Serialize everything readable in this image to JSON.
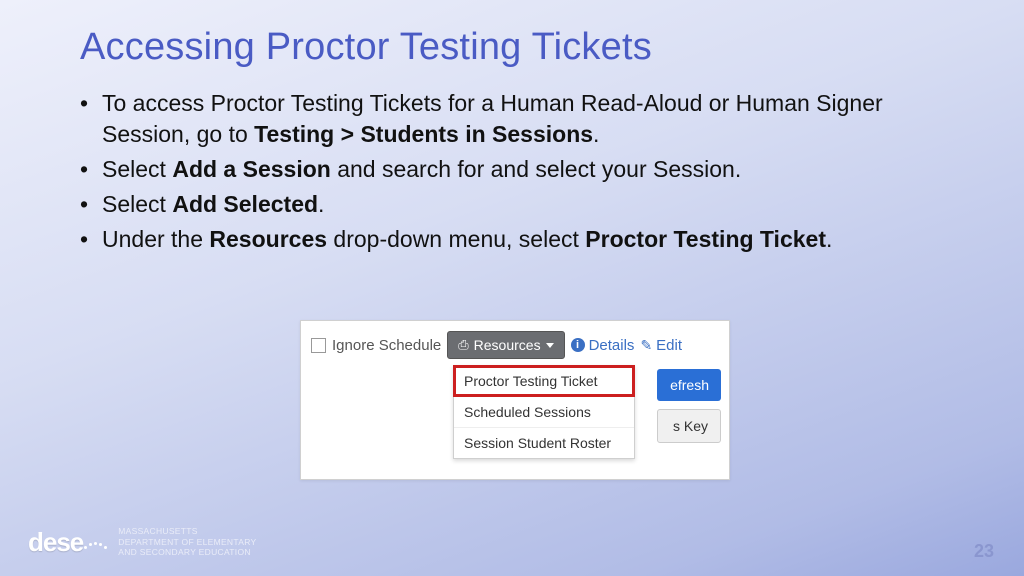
{
  "title": "Accessing Proctor Testing Tickets",
  "bullets": [
    {
      "pre": "To access Proctor Testing Tickets for a Human Read-Aloud or Human Signer Session, go to ",
      "bold": "Testing > Students in Sessions",
      "post": "."
    },
    {
      "pre": "Select ",
      "bold": "Add a Session",
      "post": " and search for and select your Session."
    },
    {
      "pre": "Select ",
      "bold": "Add Selected",
      "post": "."
    },
    {
      "pre": "Under the ",
      "bold": "Resources",
      "mid": " drop-down menu, select ",
      "bold2": "Proctor Testing Ticket",
      "post": "."
    }
  ],
  "screenshot": {
    "ignore_label": "Ignore Schedule",
    "resources_label": "Resources",
    "details_label": "Details",
    "edit_label": "Edit",
    "dropdown": [
      "Proctor Testing Ticket",
      "Scheduled Sessions",
      "Session Student Roster"
    ],
    "refresh_label": "efresh",
    "key_label": "s Key"
  },
  "footer": {
    "logo_mark": "dese",
    "org_line1": "MASSACHUSETTS",
    "org_line2": "Department of Elementary",
    "org_line3": "and Secondary Education"
  },
  "page_number": "23"
}
